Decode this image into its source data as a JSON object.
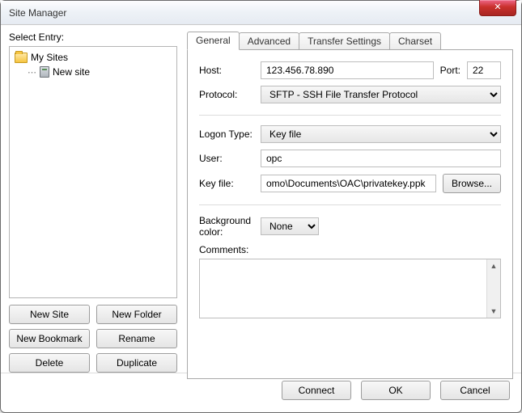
{
  "window": {
    "title": "Site Manager"
  },
  "left": {
    "select_entry_label": "Select Entry:",
    "tree": {
      "root_label": "My Sites",
      "items": [
        {
          "label": "New site"
        }
      ]
    },
    "buttons": {
      "new_site": "New Site",
      "new_folder": "New Folder",
      "new_bookmark": "New Bookmark",
      "rename": "Rename",
      "delete": "Delete",
      "duplicate": "Duplicate"
    }
  },
  "tabs": {
    "general": "General",
    "advanced": "Advanced",
    "transfer": "Transfer Settings",
    "charset": "Charset"
  },
  "general": {
    "host_label": "Host:",
    "host_value": "123.456.78.890",
    "port_label": "Port:",
    "port_value": "22",
    "protocol_label": "Protocol:",
    "protocol_value": "SFTP - SSH File Transfer Protocol",
    "logon_type_label": "Logon Type:",
    "logon_type_value": "Key file",
    "user_label": "User:",
    "user_value": "opc",
    "keyfile_label": "Key file:",
    "keyfile_value": "omo\\Documents\\OAC\\privatekey.ppk",
    "browse_label": "Browse...",
    "bg_color_label": "Background color:",
    "bg_color_value": "None",
    "comments_label": "Comments:"
  },
  "bottom": {
    "connect": "Connect",
    "ok": "OK",
    "cancel": "Cancel"
  }
}
